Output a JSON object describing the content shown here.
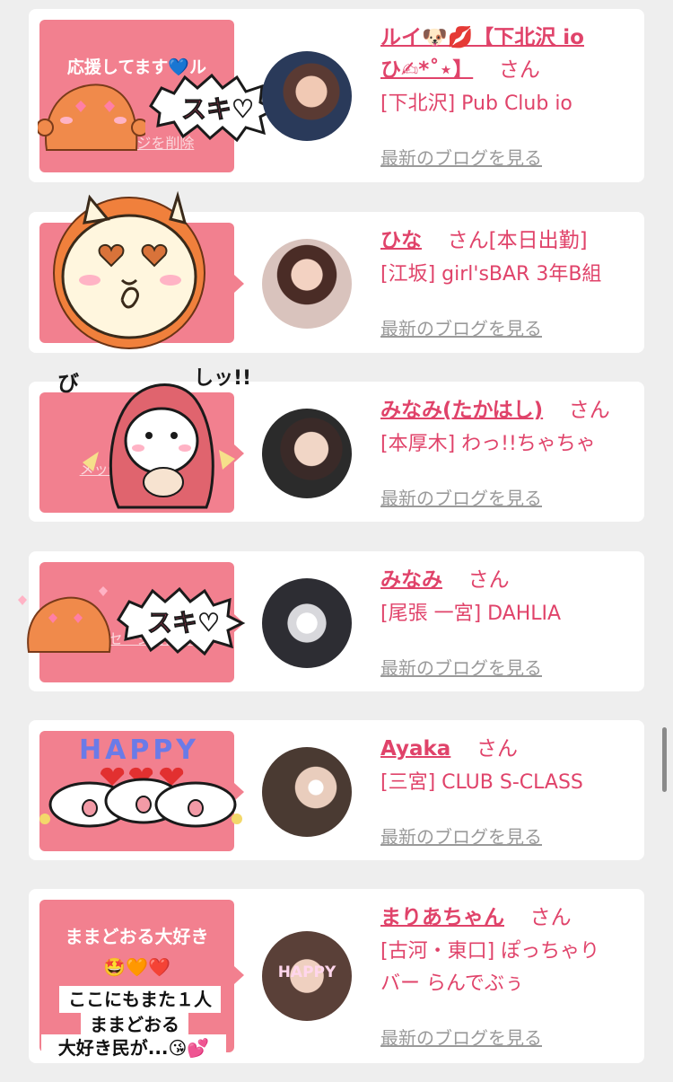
{
  "cards": [
    {
      "name": "ルイ🐶💋【下北沢 io",
      "name_cont": "ひ✍*˚⋆】",
      "suffix": "さん",
      "shop": "[下北沢] Pub Club io",
      "blog": "最新のブログを見る",
      "bubble_text": "応援してます💙ル",
      "sticker_text": "スキ♡",
      "delete_link": "メッセージを削除"
    },
    {
      "name": "ひな",
      "suffix": "さん[本日出勤]",
      "shop": "[江坂] girl'sBAR 3年B組",
      "blog": "最新のブログを見る"
    },
    {
      "name": "みなみ(たかはし)",
      "suffix": "さん",
      "shop": "[本厚木] わっ!!ちゃちゃ",
      "blog": "最新のブログを見る",
      "delete_link": "メッセージを削除",
      "sticker_text_1": "び",
      "sticker_text_2": "しッ!!"
    },
    {
      "name": "みなみ",
      "suffix": "さん",
      "shop": "[尾張 一宮] DAHLIA",
      "blog": "最新のブログを見る",
      "sticker_text": "スキ♡",
      "delete_link": "メッセージを削除"
    },
    {
      "name": "Ayaka",
      "suffix": "さん",
      "shop": "[三宮] CLUB S-CLASS",
      "blog": "最新のブログを見る",
      "sticker_text": "HAPPY"
    },
    {
      "name": "まりあちゃん",
      "suffix": "さん",
      "shop": "[古河・東口] ぽっちゃり",
      "shop_cont": "バー らんでぶぅ",
      "blog": "最新のブログを見る",
      "bubble_text_1": "ままどおる大好き",
      "bubble_text_2": "🤩🧡❤️",
      "overlay_1": "ここにもまた１人",
      "overlay_2": "ままどおる",
      "overlay_3": "大好き民が...😘💕",
      "avatar_text": "HAPPY"
    }
  ],
  "colors": {
    "accent": "#e0436a",
    "bubble": "#f2808f",
    "muted": "#9a9a9a",
    "background": "#eeeeee"
  }
}
